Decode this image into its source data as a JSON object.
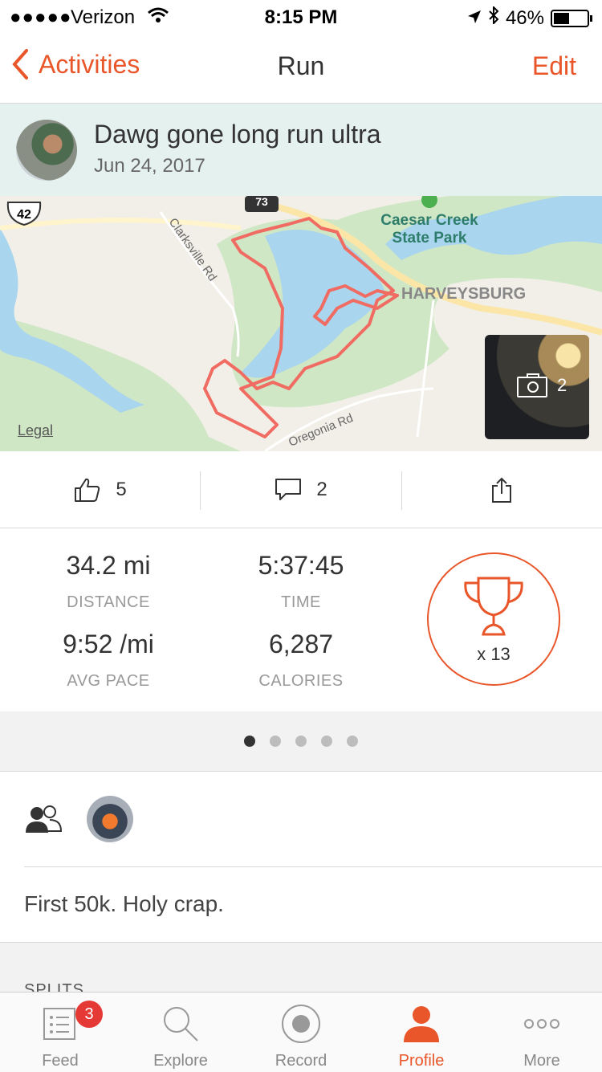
{
  "status_bar": {
    "signal": "●●●●●",
    "carrier": "Verizon",
    "time": "8:15 PM",
    "battery": "46%"
  },
  "nav": {
    "back_label": "Activities",
    "title": "Run",
    "edit_label": "Edit"
  },
  "activity": {
    "name": "Dawg gone long run ultra",
    "date": "Jun 24, 2017"
  },
  "map": {
    "labels": {
      "park_line1": "Caesar Creek",
      "park_line2": "State Park",
      "town": "HARVEYSBURG",
      "road1": "Clarksville Rd",
      "road2": "Oregonia Rd",
      "route_shield": "42",
      "route_shield2": "73"
    },
    "legal": "Legal",
    "photo_count": "2",
    "colors": {
      "water": "#a9d5ee",
      "park": "#cfe7c5",
      "route": "#f06b62"
    }
  },
  "actions": {
    "kudos_count": "5",
    "comments_count": "2"
  },
  "stats": {
    "distance": {
      "value": "34.2 mi",
      "label": "DISTANCE"
    },
    "time": {
      "value": "5:37:45",
      "label": "TIME"
    },
    "pace": {
      "value": "9:52 /mi",
      "label": "AVG PACE"
    },
    "calories": {
      "value": "6,287",
      "label": "CALORIES"
    },
    "achievements": "x 13"
  },
  "pager": {
    "pages": 5,
    "active": 1
  },
  "description": "First 50k. Holy crap.",
  "section_heading": "SPLITS",
  "tabbar": {
    "feed": "Feed",
    "feed_badge": "3",
    "explore": "Explore",
    "record": "Record",
    "profile": "Profile",
    "more": "More",
    "active": "Profile"
  },
  "colors": {
    "accent": "#e8562a"
  }
}
